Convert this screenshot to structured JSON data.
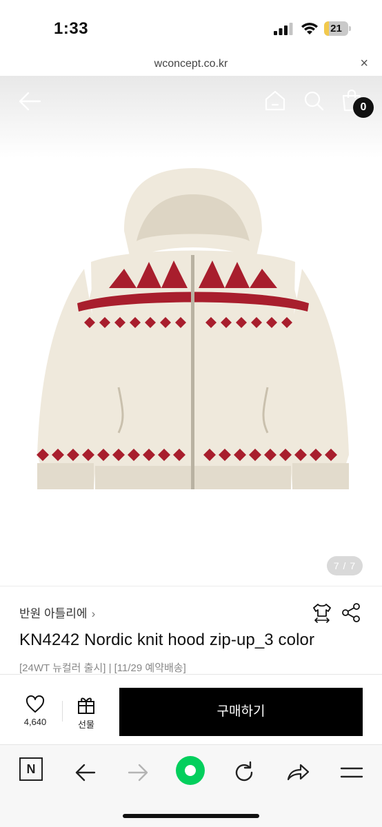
{
  "status_bar": {
    "time": "1:33",
    "battery_level": "21",
    "battery_fraction": 0.21
  },
  "browser": {
    "url": "wconcept.co.kr",
    "close_glyph": "×"
  },
  "header": {
    "cart_count": "0",
    "icons": [
      "back-arrow-icon",
      "home-icon",
      "search-icon",
      "shopping-bag-icon"
    ]
  },
  "gallery": {
    "indicator": "7 / 7"
  },
  "product": {
    "brand": "반원 아틀리에",
    "brand_chevron": "›",
    "title": "KN4242 Nordic knit hood zip-up_3 color",
    "subtitle": "[24WT 뉴컬러 출시] | [11/29 예약배송]"
  },
  "purchase": {
    "like_count": "4,640",
    "gift_label": "선물",
    "buy_label": "구매하기"
  },
  "toolbar": {
    "n_label": "N"
  },
  "colors": {
    "accent_green": "#03cf5d",
    "buy_button": "#000000",
    "sweater_red": "#a81e2d",
    "sweater_cream": "#efe9dc"
  }
}
